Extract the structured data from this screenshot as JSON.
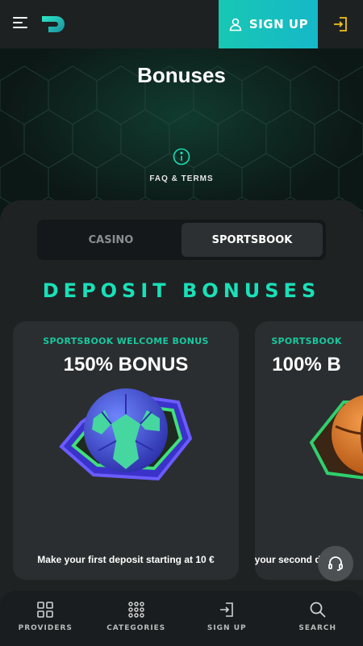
{
  "header": {
    "signup_label": "SIGN UP",
    "colors": {
      "accent": "#18c7b4",
      "login_icon": "#f0c21a"
    }
  },
  "hero": {
    "title": "Bonuses",
    "faq_label": "FAQ & TERMS"
  },
  "tabs": [
    {
      "label": "CASINO",
      "active": false
    },
    {
      "label": "SPORTSBOOK",
      "active": true
    }
  ],
  "section_title": "DEPOSIT BONUSES",
  "cards": [
    {
      "eyebrow": "SPORTSBOOK WELCOME BONUS",
      "headline": "150% BONUS",
      "description": "Make your first deposit starting at 10 €",
      "art": "soccer-ball-icon"
    },
    {
      "eyebrow": "SPORTSBOOK",
      "headline": "100% B",
      "description": "Make your second d",
      "art": "basketball-icon"
    }
  ],
  "bottom_nav": [
    {
      "label": "PROVIDERS",
      "icon": "providers-grid-icon"
    },
    {
      "label": "CATEGORIES",
      "icon": "categories-dots-icon"
    },
    {
      "label": "SIGN UP",
      "icon": "signup-enter-icon"
    },
    {
      "label": "SEARCH",
      "icon": "search-icon"
    }
  ]
}
